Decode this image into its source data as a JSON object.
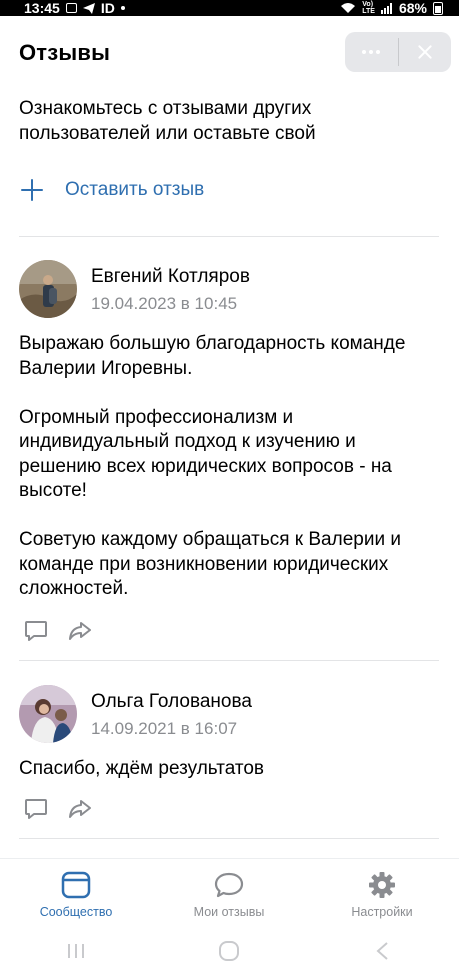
{
  "status_bar": {
    "time": "13:45",
    "carrier_badge": "ID",
    "network": "Vo)\nLTE",
    "battery": "68%"
  },
  "header": {
    "title": "Отзывы"
  },
  "intro_text": "Ознакомьтесь с отзывами других пользователей или оставьте свой",
  "leave_review_label": "Оставить отзыв",
  "reviews": [
    {
      "author": "Евгений Котляров",
      "date": "19.04.2023 в 10:45",
      "text": "Выражаю большую благодарность команде Валерии Игоревны.\n\nОгромный профессионализм и индивидуальный подход к изучению и решению всех юридических вопросов - на высоте!\n\nСоветую каждому обращаться к Валерии и команде при возникновении юридических сложностей."
    },
    {
      "author": "Ольга Голованова",
      "date": "14.09.2021 в 16:07",
      "text": "Спасибо, ждём результатов"
    }
  ],
  "bottom_nav": {
    "items": [
      {
        "label": "Сообщество",
        "icon": "community-icon",
        "active": true
      },
      {
        "label": "Мои отзывы",
        "icon": "chat-bubble-icon",
        "active": false
      },
      {
        "label": "Настройки",
        "icon": "gear-icon",
        "active": false
      }
    ]
  },
  "colors": {
    "accent": "#2f6fb0",
    "secondary_text": "#8a8c90",
    "capsule_bg": "#e6e7ea"
  }
}
